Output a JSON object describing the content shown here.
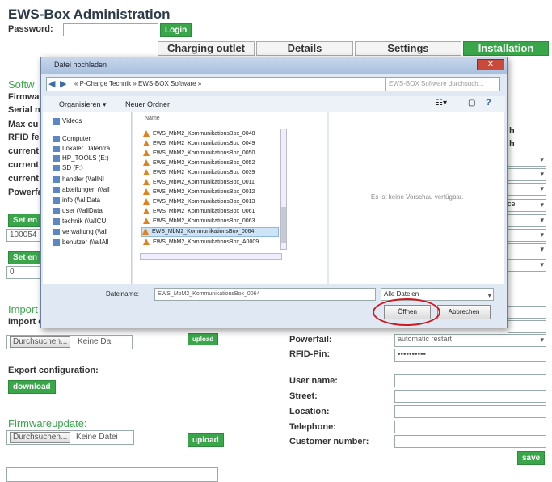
{
  "app": {
    "title": "EWS-Box Administration",
    "password_label": "Password:",
    "login_label": "Login"
  },
  "tabs": [
    {
      "label": "Charging outlet",
      "active": false
    },
    {
      "label": "Details",
      "active": false
    },
    {
      "label": "Settings",
      "active": false
    },
    {
      "label": "Installation",
      "active": true
    }
  ],
  "left": {
    "software_partial": "Softw",
    "rows": [
      "Firmwa",
      "Serial n",
      "Max cu",
      "RFID fe",
      "current",
      "current",
      "current",
      "Powerfa"
    ],
    "set_buttons": [
      "Set en",
      "Set en"
    ],
    "input_value": "100054",
    "input2_value": "0",
    "import_heading": "Import",
    "import_label": "Import c",
    "browse_label": "Durchsuchen...",
    "no_file_label": "Keine Da",
    "upload_label": "upload",
    "export_label": "Export configuration:",
    "download_label": "download",
    "firmware_heading": "Firmwareupdate:",
    "fw_browse_label": "Durchsuchen...",
    "fw_no_file_label": "Keine Datei",
    "fw_upload_label": "upload"
  },
  "right": {
    "partial_h1": "h",
    "partial_h2": "h",
    "select_value": "nce",
    "powerfail_label": "Powerfail:",
    "powerfail_value": "automatic restart",
    "rfid_pin_label": "RFID-Pin:",
    "rfid_pin_value": "••••••••••",
    "user_name_label": "User name:",
    "street_label": "Street:",
    "location_label": "Location:",
    "telephone_label": "Telephone:",
    "customer_number_label": "Customer number:",
    "save_label": "save"
  },
  "dialog": {
    "title": "Datei hochladen",
    "address": "« P-Charge Technik » EWS-BOX Software »",
    "search_placeholder": "EWS-BOX Software durchsuch...",
    "organize_label": "Organisieren ▾",
    "new_folder_label": "Neuer Ordner",
    "column_name": "Name",
    "nav_items": [
      "Videos",
      "Computer",
      "Lokaler Datenträ",
      "HP_TOOLS (E:)",
      "SD (F:)",
      "handler (\\\\allNI",
      "abteilungen (\\\\all",
      "info (\\\\allData",
      "user (\\\\allData",
      "technik (\\\\allCU",
      "verwaltung (\\\\all",
      "benutzer (\\\\allAll"
    ],
    "files": [
      "EWS_MbM2_KommunikationsBox_0048",
      "EWS_MbM2_KommunikationsBox_0049",
      "EWS_MbM2_KommunikationsBox_0050",
      "EWS_MbM2_KommunikationsBox_0052",
      "EWS_MbM2_KommunikationsBox_0039",
      "EWS_MbM2_KommunikationsBox_0011",
      "EWS_MbM2_KommunikationsBox_0012",
      "EWS_MbM2_KommunikationsBox_0013",
      "EWS_MbM2_KommunikationsBox_0061",
      "EWS_MbM2_KommunikationsBox_0063",
      "EWS_MbM2_KommunikationsBox_0064",
      "EWS_MbM2_KommunikationsBox_A0009"
    ],
    "preview_text": "Es ist keine Vorschau verfügbar.",
    "filename_label": "Dateiname:",
    "filename_value": "EWS_MbM2_KommunikationsBox_0064",
    "filetype_value": "Alle Dateien",
    "open_label": "Öffnen",
    "cancel_label": "Abbrechen",
    "highlight_color": "#d0181f"
  }
}
